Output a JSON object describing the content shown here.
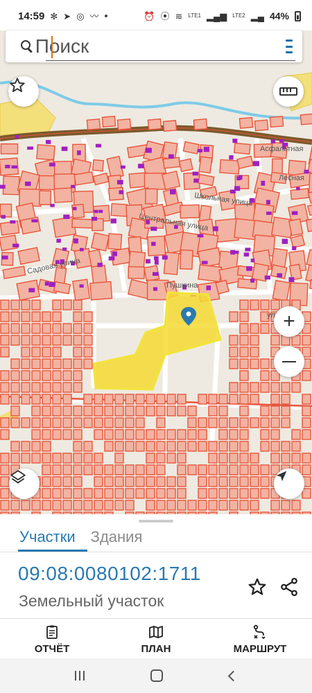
{
  "status_bar": {
    "time": "14:59",
    "battery": "44%",
    "network_1": "LTE1",
    "network_2": "LTE2"
  },
  "search": {
    "placeholder": "Поиск"
  },
  "map": {
    "labels": [
      "Школьная улица",
      "Центральная улица",
      "Садовая улица",
      "Пушкина",
      "улица",
      "Асфальтная",
      "Лесная"
    ],
    "colors": {
      "parcel_stroke": "#e8553b",
      "parcel_fill": "#f2b3a2",
      "selected_parcel": "#f5d932",
      "building": "#a020c0",
      "main_road": "#7a5a2c",
      "water": "#7ecbe8",
      "zone": "#f4e07a"
    }
  },
  "tabs": {
    "parcels": "Участки",
    "buildings": "Здания"
  },
  "card": {
    "cadastral_number": "09:08:0080102:1711",
    "type": "Земельный участок"
  },
  "actions": {
    "report": "ОТЧЁТ",
    "plan": "ПЛАН",
    "route": "МАРШРУТ"
  },
  "accent_color": "#2a7ab0"
}
